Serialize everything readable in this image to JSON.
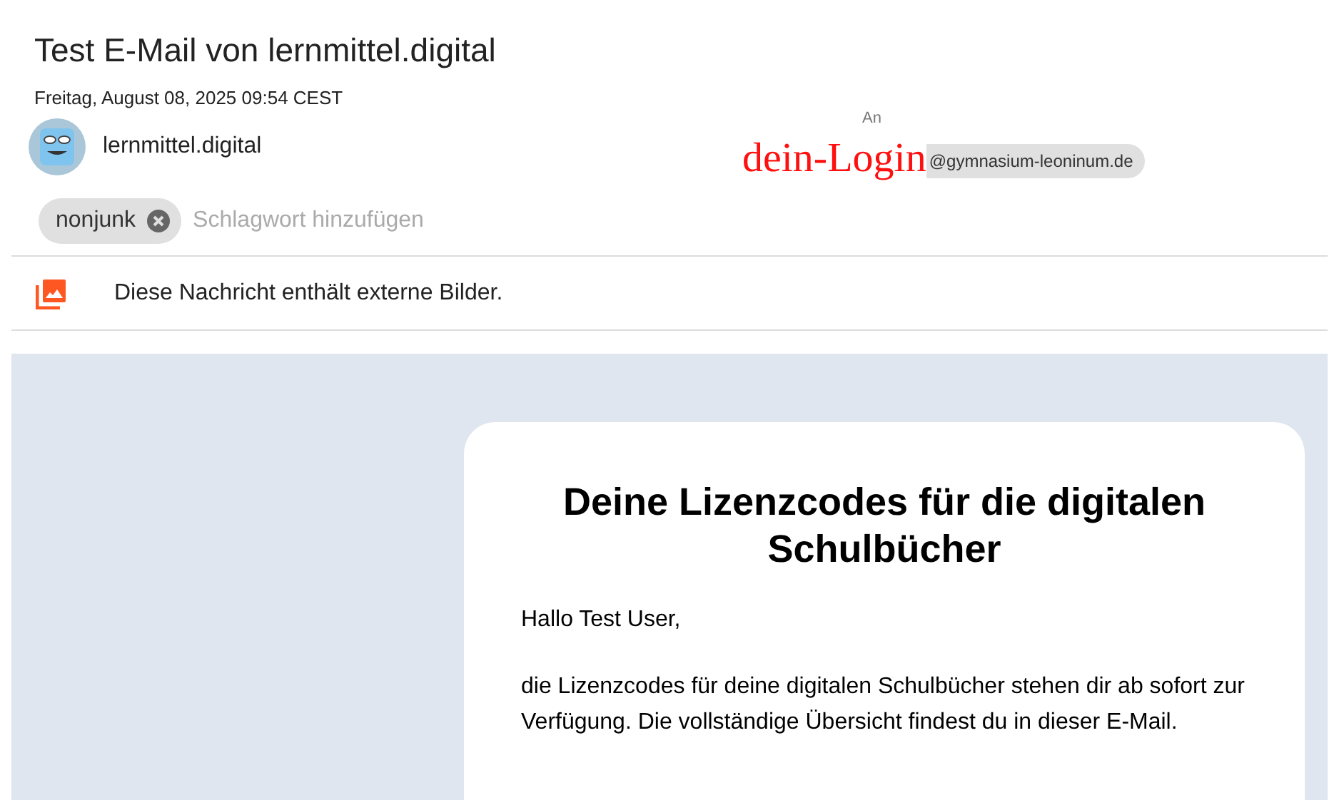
{
  "subject": "Test E-Mail von lernmittel.digital",
  "date": "Freitag, August 08, 2025 09:54 CEST",
  "sender": {
    "name": "lernmittel.digital"
  },
  "recipient": {
    "label": "An",
    "logo_text": "dein-Login",
    "address": "@gymnasium-leoninum.de"
  },
  "tags": [
    {
      "label": "nonjunk"
    }
  ],
  "tag_input": {
    "placeholder": "Schlagwort hinzufügen"
  },
  "notice": {
    "text": "Diese Nachricht enthält externe Bilder."
  },
  "body": {
    "heading": "Deine Lizenzcodes für die digitalen Schulbücher",
    "paragraphs": [
      "Hallo Test User,",
      "die Lizenzcodes für deine digitalen Schulbücher stehen dir ab sofort zur Verfügung. Die vollständige Übersicht findest du in dieser E-Mail."
    ]
  }
}
